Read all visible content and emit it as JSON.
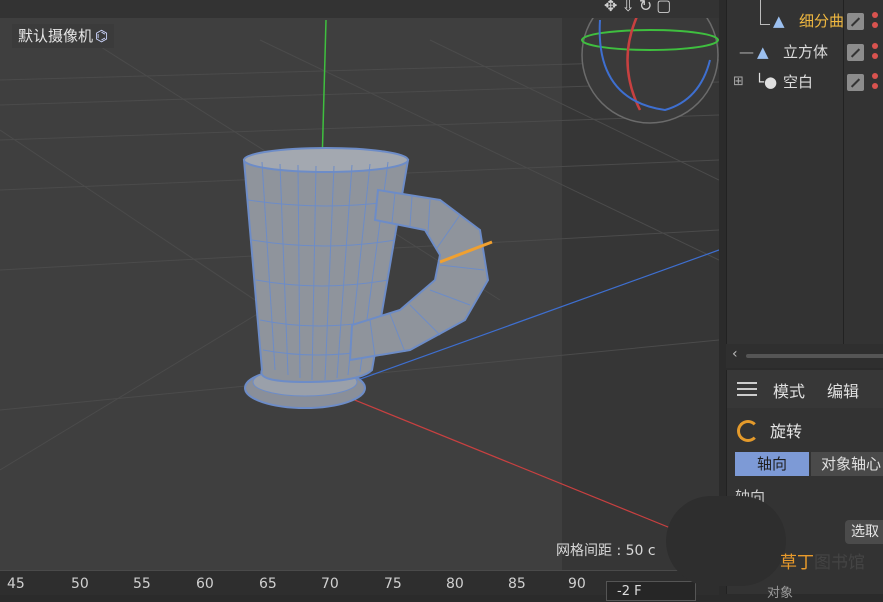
{
  "viewport": {
    "camera_label": "默认摄像机",
    "camera_icon": "video-camera-icon",
    "grid_spacing_text": "网格间距 : 50 c",
    "nav_icons": [
      "move-view-icon",
      "zoom-view-icon",
      "rotate-view-icon",
      "maximize-view-icon"
    ]
  },
  "timeline": {
    "ticks": [
      "45",
      "50",
      "55",
      "60",
      "65",
      "70",
      "75",
      "80",
      "85",
      "90"
    ],
    "frame_field": "-2 F"
  },
  "objects": {
    "rows": [
      {
        "name": "细分曲",
        "icon": "subdivision-icon",
        "color": "#f0b840"
      },
      {
        "name": "立方体",
        "icon": "cube-icon",
        "color": "#dcdcdc"
      },
      {
        "name": "空白",
        "icon": "null-object-icon",
        "color": "#dcdcdc"
      }
    ]
  },
  "attributes": {
    "menu": [
      "模式",
      "编辑"
    ],
    "tool_name": "旋转",
    "tabs": [
      "轴向",
      "对象轴心"
    ],
    "section_label": "轴向",
    "bottom_text": "对象"
  },
  "select_button": "选取",
  "watermark": {
    "accent": "草丁",
    "rest": "图书馆"
  },
  "colors": {
    "y_axis": "#3fbf3f",
    "x_axis": "#c84040",
    "z_axis": "#3e6fd0",
    "selection_edge": "#f0a030",
    "active_tab": "#7d9ad6"
  }
}
